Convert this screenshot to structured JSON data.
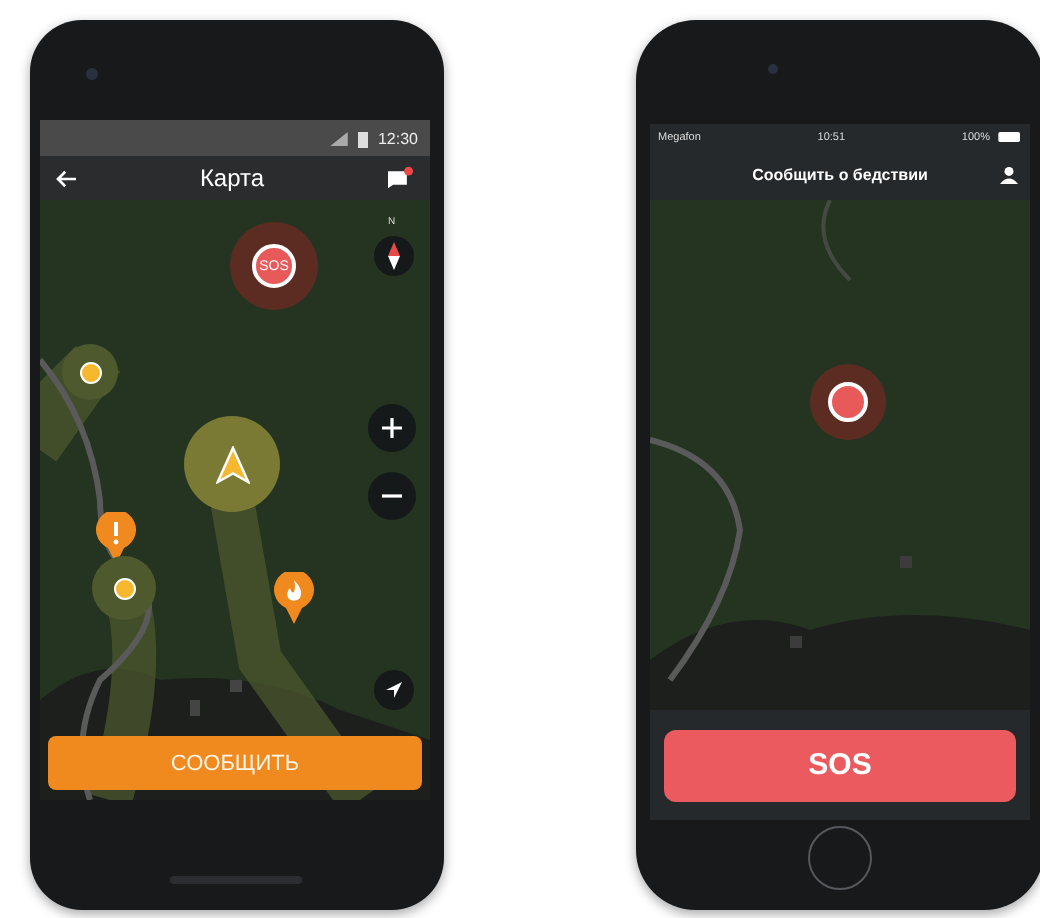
{
  "left_phone": {
    "status_bar": {
      "time": "12:30"
    },
    "header": {
      "title": "Карта",
      "notification_unread": true
    },
    "map": {
      "sos_marker": "SOS",
      "compass_label": "N"
    },
    "report_button": "СООБЩИТЬ"
  },
  "right_phone": {
    "status_bar": {
      "carrier": "Megafon",
      "time": "10:51",
      "battery": "100%"
    },
    "header": {
      "title": "Сообщить о бедствии"
    },
    "sos_button": "SOS"
  }
}
